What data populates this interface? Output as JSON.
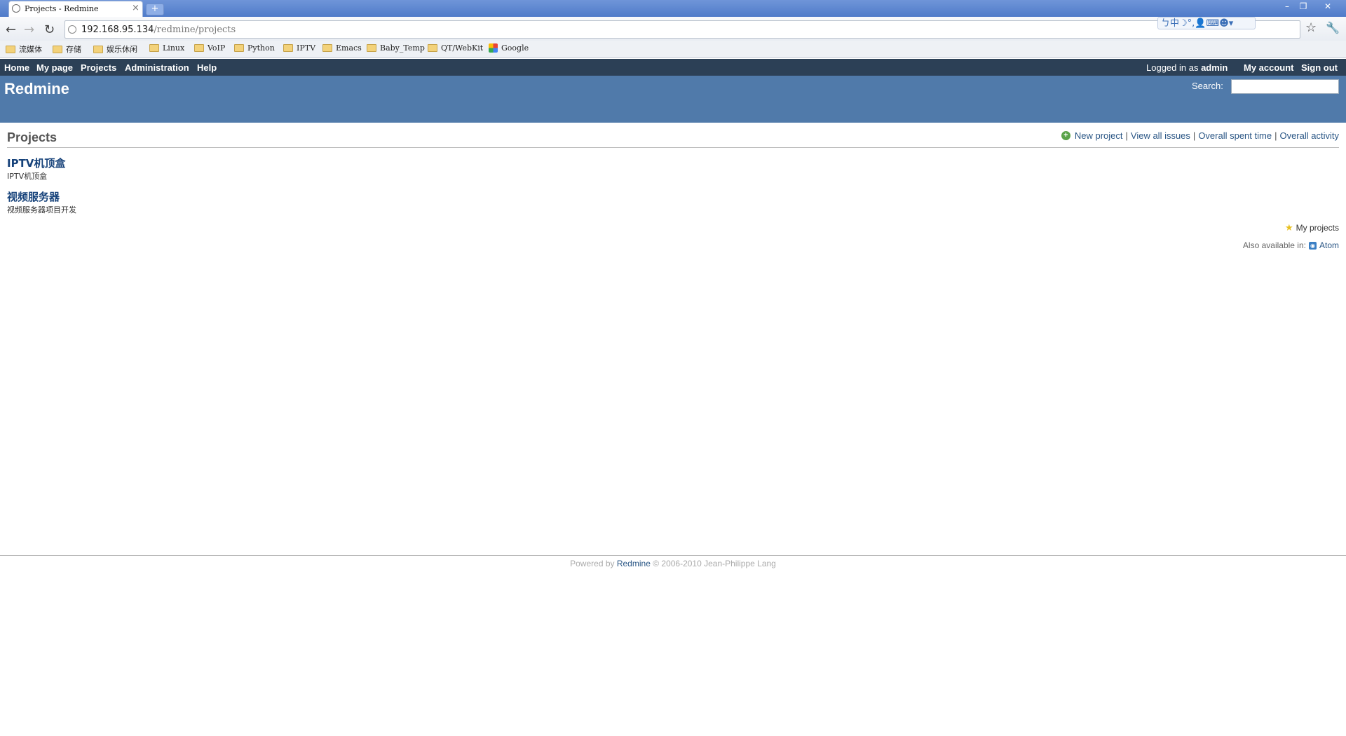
{
  "browser": {
    "tab_title": "Projects - Redmine",
    "new_tab_label": "+",
    "window_controls": [
      "–",
      "❐",
      "✕"
    ],
    "url_host": "192.168.95.134",
    "url_path": "/redmine/projects",
    "ime_status": "ㄅ中☽°,👤⌨☻▾"
  },
  "bookmarks": [
    {
      "label": "流媒体",
      "icon": "folder-icon"
    },
    {
      "label": "存储",
      "icon": "folder-icon"
    },
    {
      "label": "娱乐休闲",
      "icon": "folder-icon"
    },
    {
      "label": "Linux",
      "icon": "folder-icon"
    },
    {
      "label": "VoIP",
      "icon": "folder-icon"
    },
    {
      "label": "Python",
      "icon": "folder-icon"
    },
    {
      "label": "IPTV",
      "icon": "folder-icon"
    },
    {
      "label": "Emacs",
      "icon": "folder-icon"
    },
    {
      "label": "Baby_Temp",
      "icon": "folder-icon"
    },
    {
      "label": "QT/WebKit",
      "icon": "folder-icon"
    },
    {
      "label": "Google",
      "icon": "google-icon"
    }
  ],
  "top_menu": {
    "home": "Home",
    "my_page": "My page",
    "projects": "Projects",
    "administration": "Administration",
    "help": "Help",
    "logged_in_prefix": "Logged in as",
    "user": "admin",
    "my_account": "My account",
    "sign_out": "Sign out"
  },
  "header": {
    "title": "Redmine",
    "search_label": "Search:"
  },
  "content": {
    "title": "Projects",
    "contextual": {
      "new_project": "New project",
      "view_all_issues": "View all issues",
      "overall_spent_time": "Overall spent time",
      "overall_activity": "Overall activity",
      "separator": "|"
    },
    "projects": [
      {
        "name": "IPTV机顶盒",
        "description": "IPTV机顶盒"
      },
      {
        "name": "视频服务器",
        "description": "视频服务器项目开发"
      }
    ],
    "my_projects": "My projects",
    "also_available_in": "Also available in:",
    "atom": "Atom"
  },
  "footer": {
    "powered_by": "Powered by",
    "redmine": "Redmine",
    "copyright": "© 2006-2010 Jean-Philippe Lang"
  }
}
